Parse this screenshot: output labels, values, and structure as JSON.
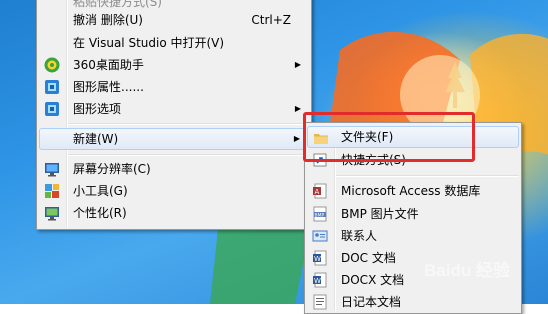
{
  "main_menu": {
    "top_cut_item": "粘贴快捷方式(S)",
    "items": [
      {
        "label": "撤消 删除(U)",
        "shortcut": "Ctrl+Z"
      },
      {
        "label": "在 Visual Studio 中打开(V)"
      },
      {
        "label": "360桌面助手",
        "icon": "360-icon"
      },
      {
        "label": "图形属性......",
        "icon": "graphics-icon"
      },
      {
        "label": "图形选项",
        "icon": "graphics-options-icon"
      },
      {
        "label": "新建(W)"
      },
      {
        "label": "屏幕分辨率(C)",
        "icon": "monitor-icon"
      },
      {
        "label": "小工具(G)",
        "icon": "gadgets-icon"
      },
      {
        "label": "个性化(R)",
        "icon": "personalize-icon"
      }
    ]
  },
  "submenu": {
    "items": [
      {
        "label": "文件夹(F)",
        "icon": "folder-icon"
      },
      {
        "label": "快捷方式(S)",
        "icon": "shortcut-icon"
      },
      {
        "label": "Microsoft Access 数据库",
        "icon": "access-icon"
      },
      {
        "label": "BMP 图片文件",
        "icon": "bmp-icon"
      },
      {
        "label": "联系人",
        "icon": "contact-icon"
      },
      {
        "label": "DOC 文档",
        "icon": "doc-icon"
      },
      {
        "label": "DOCX 文档",
        "icon": "docx-icon"
      },
      {
        "label": "日记本文档",
        "icon": "journal-icon"
      }
    ]
  },
  "watermark": "Baidu 经验",
  "colors": {
    "highlight_box": "#e22b2b",
    "menu_bg": "#f0f0f0"
  }
}
